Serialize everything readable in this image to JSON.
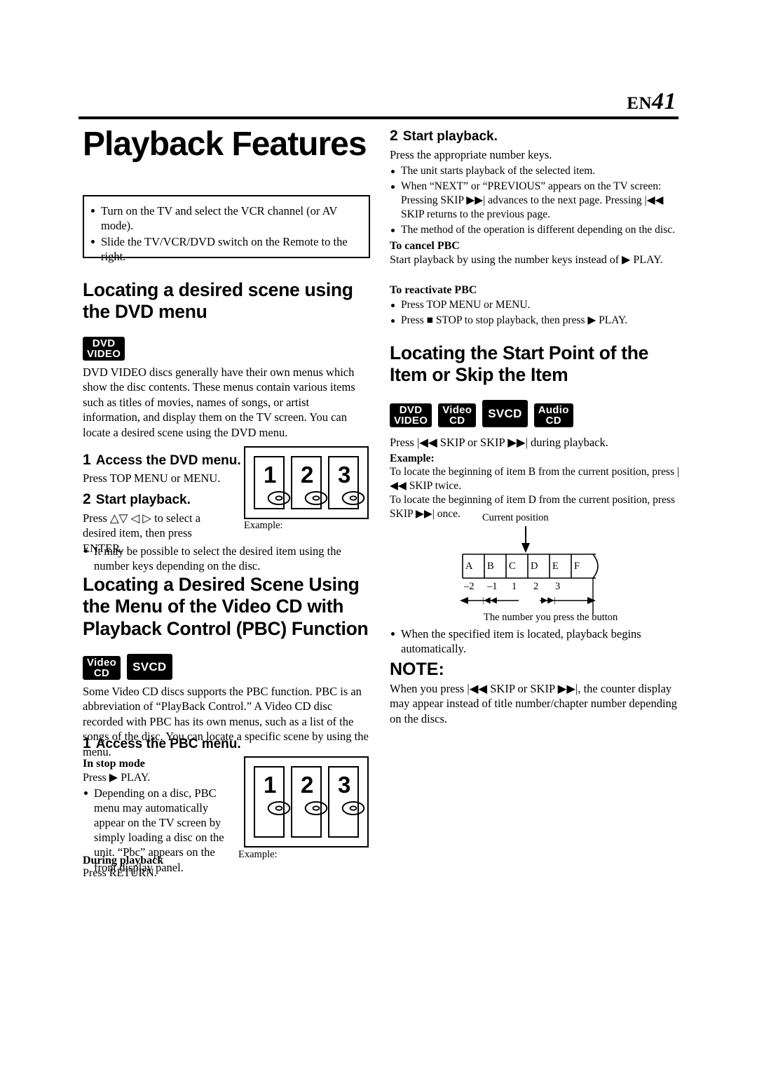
{
  "header": {
    "en_label": "EN",
    "page_number": "41"
  },
  "title": "Playback Features",
  "intro_box": {
    "items": [
      "Turn on the TV and select the VCR channel (or AV mode).",
      "Slide the TV/VCR/DVD switch on the Remote to the right."
    ]
  },
  "section_dvd": {
    "heading": "Locating a desired scene using the DVD menu",
    "logos": [
      {
        "line1": "DVD",
        "line2": "VIDEO"
      }
    ],
    "body": "DVD VIDEO discs generally have their own menus which show the disc contents. These menus contain various items such as titles of movies, names of songs, or artist information, and display them on the TV screen. You can locate a desired scene using the DVD menu.",
    "step1_num": "1",
    "step1_title": "Access the DVD menu.",
    "step1_text": "Press TOP MENU or MENU.",
    "step2_num": "2",
    "step2_title": "Start playback.",
    "step2_text": "Press △▽ ◁ ▷ to select a desired item, then press ENTER.",
    "step2_bullet": "It may be possible to select the desired item using the number keys depending on the disc.",
    "example_label": "Example:",
    "menu_numbers": [
      "1",
      "2",
      "3"
    ]
  },
  "section_pbc": {
    "heading": "Locating a Desired Scene Using the Menu of the Video CD with Playback Control (PBC) Function",
    "logos": [
      {
        "line1": "Video",
        "line2": "CD"
      },
      {
        "line1": "SVCD",
        "line2": ""
      }
    ],
    "body": "Some Video CD discs supports the PBC function. PBC is an abbreviation of “PlayBack Control.” A Video CD disc recorded with PBC has its own menus, such as a list of the songs of the disc. You can locate a specific scene by using the menu.",
    "step1_num": "1",
    "step1_title": "Access the PBC menu.",
    "stop_mode_label": "In stop mode",
    "stop_mode_text": "Press ▶ PLAY.",
    "stop_mode_bullet": "Depending on a disc, PBC menu may automatically appear on the TV screen by simply loading a disc on the unit. “Pbc” appears on the front display panel.",
    "during_label": "During playback",
    "during_text": "Press RETURN.",
    "example_label": "Example:",
    "menu_numbers": [
      "1",
      "2",
      "3"
    ]
  },
  "right_top": {
    "step2_num": "2",
    "step2_title": "Start playback.",
    "lead": "Press the appropriate number keys.",
    "bullets": [
      "The unit starts playback of the selected item.",
      "When “NEXT” or “PREVIOUS” appears on the TV screen: Pressing SKIP ▶▶| advances to the next page. Pressing |◀◀ SKIP returns to the previous page.",
      "The method of the operation is different depending on the disc."
    ],
    "cancel_label": "To cancel PBC",
    "cancel_text": "Start playback by using the number keys instead of ▶ PLAY.",
    "reactivate_label": "To reactivate PBC",
    "reactivate_bullets": [
      "Press TOP MENU or MENU.",
      "Press ■ STOP to stop playback, then press ▶ PLAY."
    ]
  },
  "section_skip": {
    "heading": "Locating the Start Point of the Item or Skip the Item",
    "logos": [
      {
        "line1": "DVD",
        "line2": "VIDEO"
      },
      {
        "line1": "Video",
        "line2": "CD"
      },
      {
        "line1": "SVCD",
        "line2": ""
      },
      {
        "line1": "Audio",
        "line2": "CD"
      }
    ],
    "lead": "Press |◀◀ SKIP or SKIP ▶▶| during playback.",
    "example_label": "Example:",
    "example_text1": "To locate the beginning of item B from the current position, press |◀◀ SKIP twice.",
    "example_text2": "To locate the beginning of item D from the current position, press SKIP ▶▶| once.",
    "diagram": {
      "current_position_label": "Current position",
      "items": [
        "A",
        "B",
        "C",
        "D",
        "E",
        "F"
      ],
      "numbers": [
        "–2",
        "–1",
        "1",
        "2",
        "3"
      ],
      "left_key": "|◀◀",
      "right_key": "▶▶|",
      "caption": "The number you press the button"
    },
    "bullet": "When the specified item is located, playback begins automatically.",
    "note_label": "NOTE:",
    "note_text": "When you press |◀◀ SKIP or SKIP ▶▶|, the counter display may appear instead of title number/chapter number depending on the discs."
  }
}
